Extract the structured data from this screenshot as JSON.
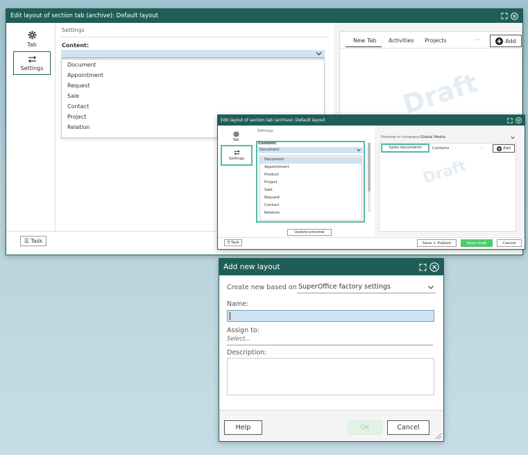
{
  "win1": {
    "title": "Edit layout of section tab (archive): Default layout",
    "sidebar": {
      "tab_label": "Tab",
      "settings_label": "Settings"
    },
    "settings_heading": "Settings",
    "content_label": "Content:",
    "content_value": "",
    "options": [
      "Document",
      "Appointment",
      "Request",
      "Sale",
      "Contact",
      "Project",
      "Relation"
    ],
    "tabs": [
      "New Tab",
      "Activities",
      "Projects"
    ],
    "more": "···",
    "add_label": "Add",
    "watermark": "Draft",
    "task_label": "Task"
  },
  "win2": {
    "title": "Edit layout of section tab (archive): Default layout",
    "sidebar": {
      "tab_label": "Tab",
      "settings_label": "Settings"
    },
    "settings_heading": "Settings",
    "content_label": "Content:",
    "content_value": "Document",
    "options": [
      "Document",
      "Appointment",
      "Product",
      "Project",
      "Sale",
      "Request",
      "Contact",
      "Relation"
    ],
    "preview_label": "Preview of company:",
    "preview_value": "Global Media",
    "tabs": [
      "Sales documents",
      "Contacts"
    ],
    "more": "···",
    "add_label": "Add",
    "update_preview": "Update preview",
    "watermark": "Draft",
    "task_label": "Task",
    "save_publish": "Save + Publish",
    "save_draft": "Save draft",
    "cancel": "Cancel"
  },
  "dialog": {
    "title": "Add new layout",
    "based_on_label": "Create new based on",
    "based_on_value": "SuperOffice factory settings",
    "name_label": "Name:",
    "name_value": "",
    "assign_label": "Assign to:",
    "assign_placeholder": "Select...",
    "description_label": "Description:",
    "help": "Help",
    "ok": "OK",
    "cancel": "Cancel"
  },
  "colors": {
    "brand": "#1f5e56",
    "accent_green": "#4ecb6e",
    "teal_highlight": "#53b9a6",
    "selection_blue": "#cfe3f3"
  }
}
